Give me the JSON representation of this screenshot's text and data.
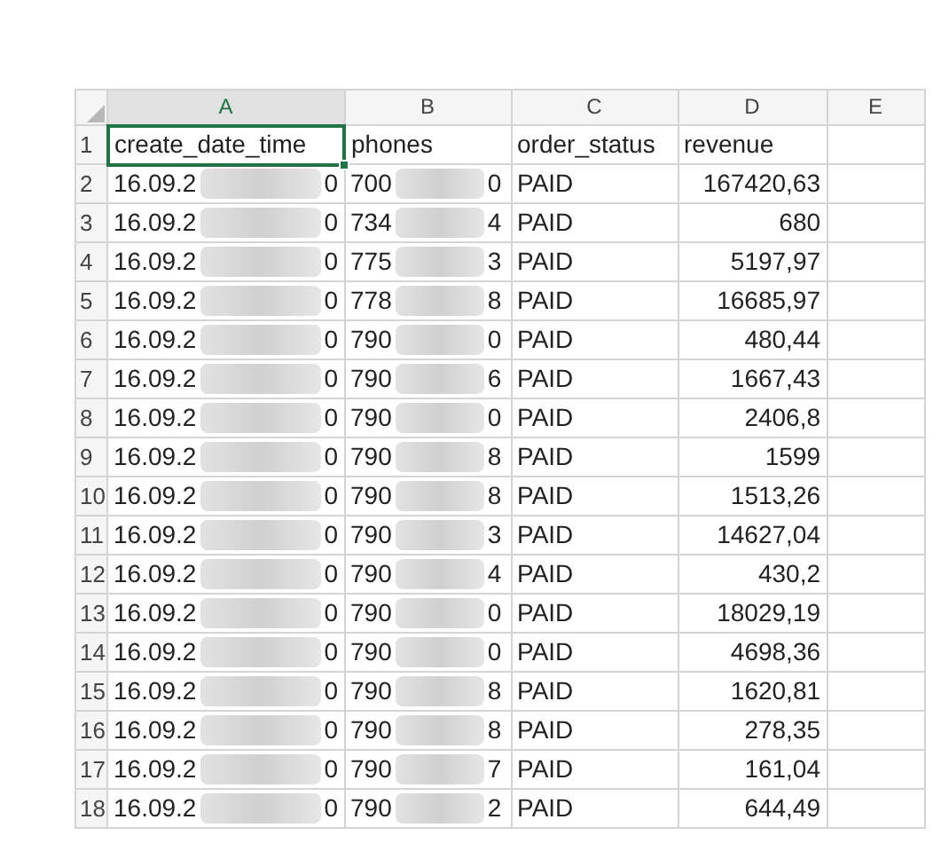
{
  "columns": [
    {
      "label": "A",
      "selected": true
    },
    {
      "label": "B",
      "selected": false
    },
    {
      "label": "C",
      "selected": false
    },
    {
      "label": "D",
      "selected": false
    },
    {
      "label": "E",
      "selected": false
    }
  ],
  "header_row": {
    "number": "1",
    "cells": [
      {
        "text": "create_date_time",
        "selected": true
      },
      {
        "text": "phones",
        "selected": false
      },
      {
        "text": "order_status",
        "selected": false
      },
      {
        "text": "revenue",
        "selected": false
      }
    ]
  },
  "rows": [
    {
      "number": "2",
      "date_start": "16.09.2",
      "date_end": "0",
      "phone_start": "700",
      "phone_end": "0",
      "status": "PAID",
      "revenue": "167420,63"
    },
    {
      "number": "3",
      "date_start": "16.09.2",
      "date_end": "0",
      "phone_start": "734",
      "phone_end": "4",
      "status": "PAID",
      "revenue": "680"
    },
    {
      "number": "4",
      "date_start": "16.09.2",
      "date_end": "0",
      "phone_start": "775",
      "phone_end": "3",
      "status": "PAID",
      "revenue": "5197,97"
    },
    {
      "number": "5",
      "date_start": "16.09.2",
      "date_end": "0",
      "phone_start": "778",
      "phone_end": "8",
      "status": "PAID",
      "revenue": "16685,97"
    },
    {
      "number": "6",
      "date_start": "16.09.2",
      "date_end": "0",
      "phone_start": "790",
      "phone_end": "0",
      "status": "PAID",
      "revenue": "480,44"
    },
    {
      "number": "7",
      "date_start": "16.09.2",
      "date_end": "0",
      "phone_start": "790",
      "phone_end": "6",
      "status": "PAID",
      "revenue": "1667,43"
    },
    {
      "number": "8",
      "date_start": "16.09.2",
      "date_end": "0",
      "phone_start": "790",
      "phone_end": "0",
      "status": "PAID",
      "revenue": "2406,8"
    },
    {
      "number": "9",
      "date_start": "16.09.2",
      "date_end": "0",
      "phone_start": "790",
      "phone_end": "8",
      "status": "PAID",
      "revenue": "1599"
    },
    {
      "number": "10",
      "date_start": "16.09.2",
      "date_end": "0",
      "phone_start": "790",
      "phone_end": "8",
      "status": "PAID",
      "revenue": "1513,26"
    },
    {
      "number": "11",
      "date_start": "16.09.2",
      "date_end": "0",
      "phone_start": "790",
      "phone_end": "3",
      "status": "PAID",
      "revenue": "14627,04"
    },
    {
      "number": "12",
      "date_start": "16.09.2",
      "date_end": "0",
      "phone_start": "790",
      "phone_end": "4",
      "status": "PAID",
      "revenue": "430,2"
    },
    {
      "number": "13",
      "date_start": "16.09.2",
      "date_end": "0",
      "phone_start": "790",
      "phone_end": "0",
      "status": "PAID",
      "revenue": "18029,19"
    },
    {
      "number": "14",
      "date_start": "16.09.2",
      "date_end": "0",
      "phone_start": "790",
      "phone_end": "0",
      "status": "PAID",
      "revenue": "4698,36"
    },
    {
      "number": "15",
      "date_start": "16.09.2",
      "date_end": "0",
      "phone_start": "790",
      "phone_end": "8",
      "status": "PAID",
      "revenue": "1620,81"
    },
    {
      "number": "16",
      "date_start": "16.09.2",
      "date_end": "0",
      "phone_start": "790",
      "phone_end": "8",
      "status": "PAID",
      "revenue": "278,35"
    },
    {
      "number": "17",
      "date_start": "16.09.2",
      "date_end": "0",
      "phone_start": "790",
      "phone_end": "7",
      "status": "PAID",
      "revenue": "161,04"
    },
    {
      "number": "18",
      "date_start": "16.09.2",
      "date_end": "0",
      "phone_start": "790",
      "phone_end": "2",
      "status": "PAID",
      "revenue": "644,49"
    }
  ]
}
